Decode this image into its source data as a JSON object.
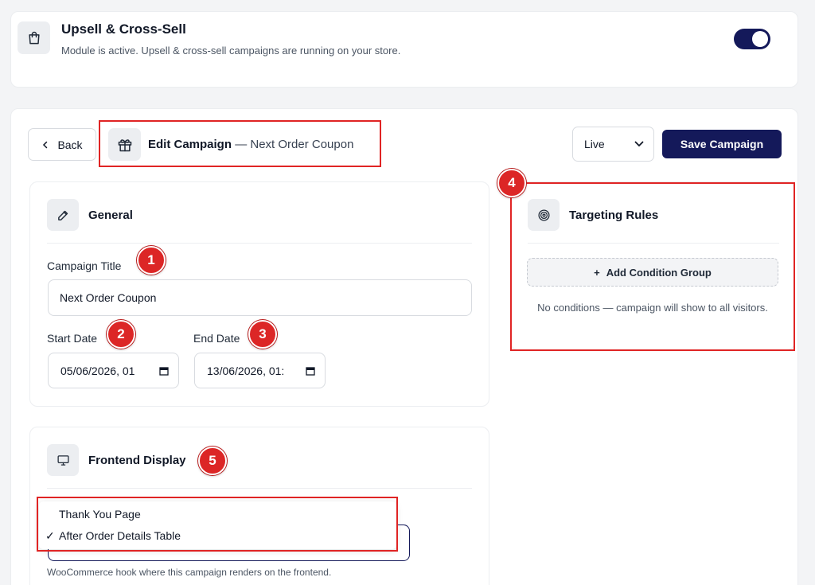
{
  "module": {
    "title": "Upsell & Cross-Sell",
    "description": "Module is active. Upsell & cross-sell campaigns are running on your store.",
    "icon": "shopping-bag-icon",
    "enabled": true
  },
  "header": {
    "back_label": "Back",
    "title_strong": "Edit Campaign",
    "title_sub": "— Next Order Coupon",
    "status_value": "Live",
    "save_label": "Save Campaign"
  },
  "general": {
    "section_title": "General",
    "campaign_title_label": "Campaign Title",
    "campaign_title_value": "Next Order Coupon",
    "start_date_label": "Start Date",
    "start_date_value": "05/06/2026, 01",
    "end_date_label": "End Date",
    "end_date_value": "13/06/2026, 01:"
  },
  "targeting": {
    "section_title": "Targeting Rules",
    "add_group_label": "Add Condition Group",
    "empty_text": "No conditions — campaign will show to all visitors."
  },
  "display": {
    "section_title": "Frontend Display",
    "options": [
      "Thank You Page",
      "After Order Details Table"
    ],
    "selected": "After Order Details Table",
    "help_text": "WooCommerce hook where this campaign renders on the frontend."
  },
  "annotations": {
    "badges": [
      "1",
      "2",
      "3",
      "4",
      "5"
    ],
    "color": "#dc2626"
  },
  "colors": {
    "brand": "#14195a",
    "background": "#f3f4f6"
  }
}
